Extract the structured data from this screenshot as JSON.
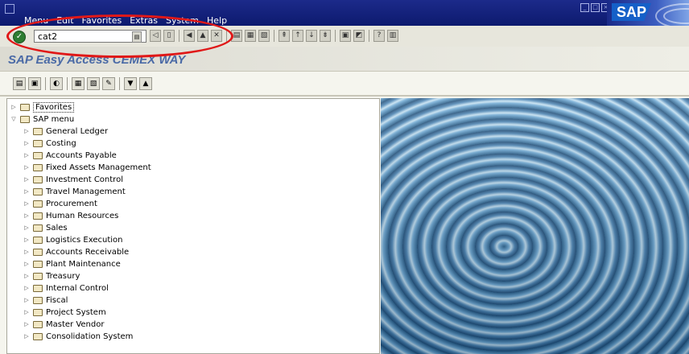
{
  "menubar": {
    "items": [
      "Menu",
      "Edit",
      "Favorites",
      "Extras",
      "System",
      "Help"
    ],
    "logo_text": "SAP"
  },
  "toolbar": {
    "command_value": "cat2"
  },
  "page": {
    "title": "SAP Easy Access  CEMEX WAY"
  },
  "tree": {
    "favorites": "Favorites",
    "root": "SAP menu",
    "items": [
      "General Ledger",
      "Costing",
      "Accounts Payable",
      "Fixed Assets Management",
      "Investment Control",
      "Travel Management",
      "Procurement",
      "Human Resources",
      "Sales",
      "Logistics Execution",
      "Accounts Receivable",
      "Plant Maintenance",
      "Treasury",
      "Internal Control",
      "Fiscal",
      "Project System",
      "Master Vendor",
      "Consolidation System"
    ]
  },
  "colors": {
    "menubar": "#1c2a8a",
    "title": "#4a6aa6",
    "highlight_oval": "#e01818"
  }
}
